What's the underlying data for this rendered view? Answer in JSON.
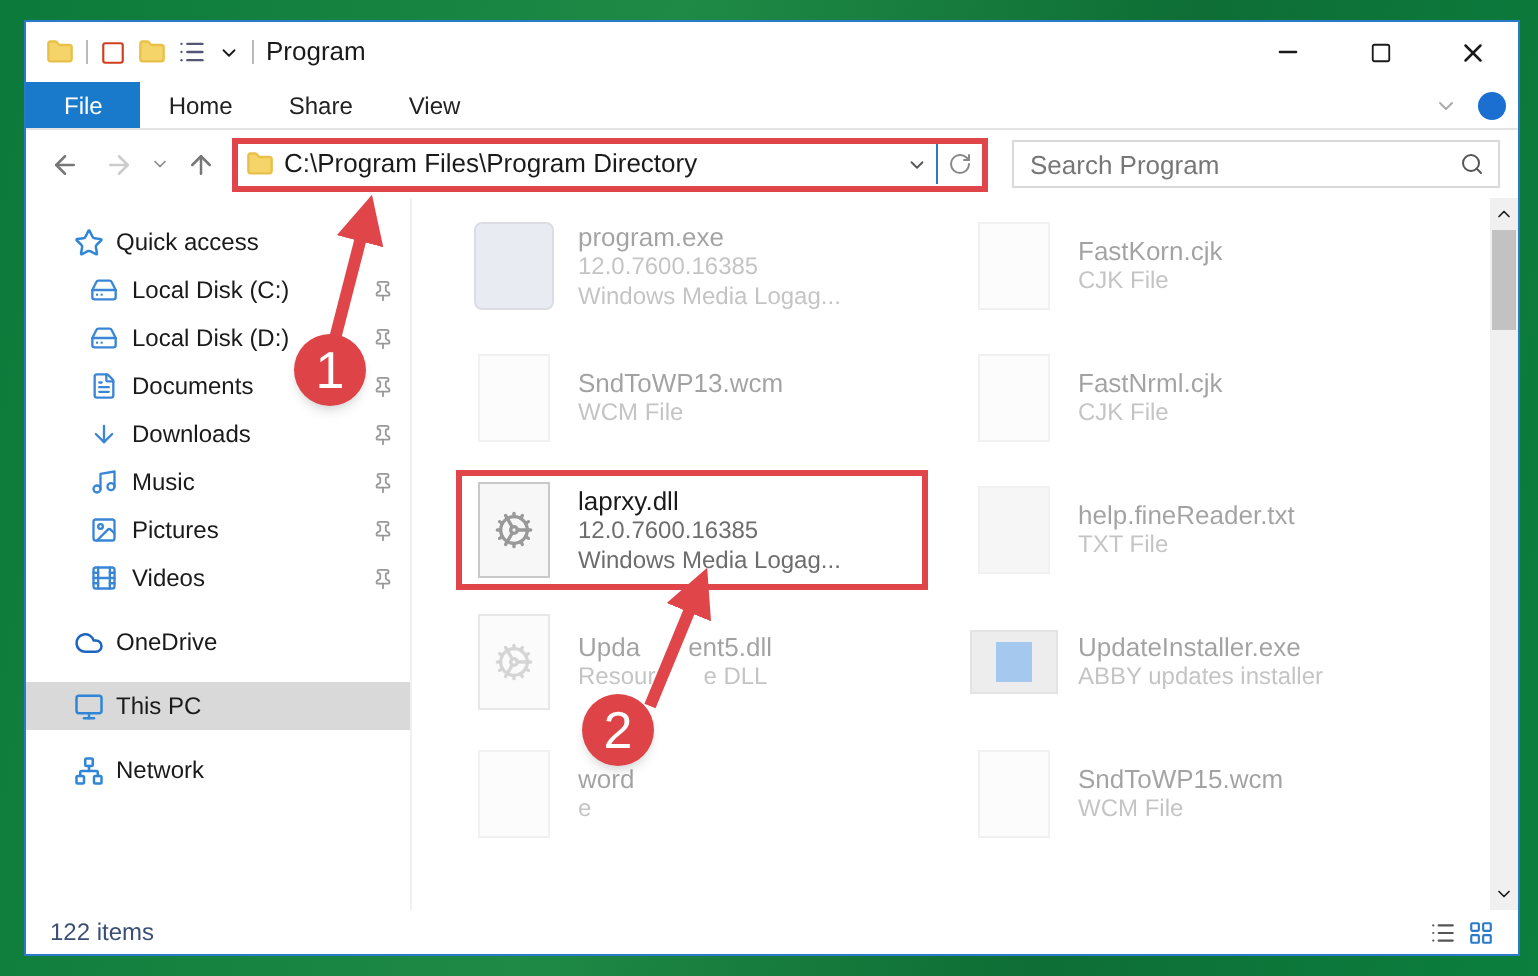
{
  "window": {
    "title": "Program"
  },
  "ribbon_tabs": [
    {
      "label": "File",
      "selected": true
    },
    {
      "label": "Home",
      "selected": false
    },
    {
      "label": "Share",
      "selected": false
    },
    {
      "label": "View",
      "selected": false
    }
  ],
  "address_bar": {
    "path": "C:\\Program Files\\Program Directory",
    "highlighted": true
  },
  "search": {
    "placeholder": "Search Program"
  },
  "sidebar": {
    "items": [
      {
        "label": "Quick access",
        "selected": false,
        "children": [
          {
            "label": "Local Disk (C:)",
            "pinned": true
          },
          {
            "label": "Local Disk (D:)",
            "pinned": true
          },
          {
            "label": "Documents",
            "pinned": true
          },
          {
            "label": "Downloads",
            "pinned": true
          },
          {
            "label": "Music",
            "pinned": true
          },
          {
            "label": "Pictures",
            "pinned": true
          },
          {
            "label": "Videos",
            "pinned": true
          }
        ]
      },
      {
        "label": "OneDrive",
        "selected": false
      },
      {
        "label": "This PC",
        "selected": true
      },
      {
        "label": "Network",
        "selected": false
      }
    ]
  },
  "files": [
    {
      "kind": "exe",
      "name": [
        "program.exe"
      ],
      "details": [
        [
          "12.0.7600.16385"
        ],
        [
          "Windows Media Logag..."
        ]
      ],
      "highlighted": false,
      "blurred": true
    },
    {
      "kind": "blank",
      "name": [
        "FastKorn.cjk"
      ],
      "details": [
        [
          "CJK File"
        ]
      ],
      "highlighted": false,
      "blurred": true
    },
    {
      "kind": "blank",
      "name": [
        "SndToWP13.wcm"
      ],
      "details": [
        [
          "WCM File"
        ]
      ],
      "highlighted": false,
      "blurred": true
    },
    {
      "kind": "blank",
      "name": [
        "FastNrml.cjk"
      ],
      "details": [
        [
          "CJK File"
        ]
      ],
      "highlighted": false,
      "blurred": true
    },
    {
      "kind": "dll",
      "name": [
        "laprxy.dll"
      ],
      "details": [
        [
          "12.0.7600.16385"
        ],
        [
          "Windows Media Logag..."
        ]
      ],
      "highlighted": true,
      "blurred": false
    },
    {
      "kind": "text",
      "name": [
        "help.fineReader.txt"
      ],
      "details": [
        [
          "TXT File"
        ]
      ],
      "highlighted": false,
      "blurred": true
    },
    {
      "kind": "dll",
      "name": [
        "Upda",
        "ent5.dll"
      ],
      "details": [
        [
          "Resour",
          "e DLL"
        ]
      ],
      "highlighted": false,
      "blurred": true
    },
    {
      "kind": "installer",
      "name": [
        "UpdateInstaller.exe"
      ],
      "details": [
        [
          "ABBY updates installer"
        ]
      ],
      "highlighted": false,
      "blurred": true
    },
    {
      "kind": "blank",
      "name": [
        "word"
      ],
      "details": [
        [
          "e"
        ]
      ],
      "highlighted": false,
      "blurred": true
    },
    {
      "kind": "blank",
      "name": [
        "SndToWP15.wcm"
      ],
      "details": [
        [
          "WCM File"
        ]
      ],
      "highlighted": false,
      "blurred": true
    }
  ],
  "status_bar": {
    "item_count": "122 items"
  },
  "annotations": [
    {
      "label": "1"
    },
    {
      "label": "2"
    }
  ]
}
